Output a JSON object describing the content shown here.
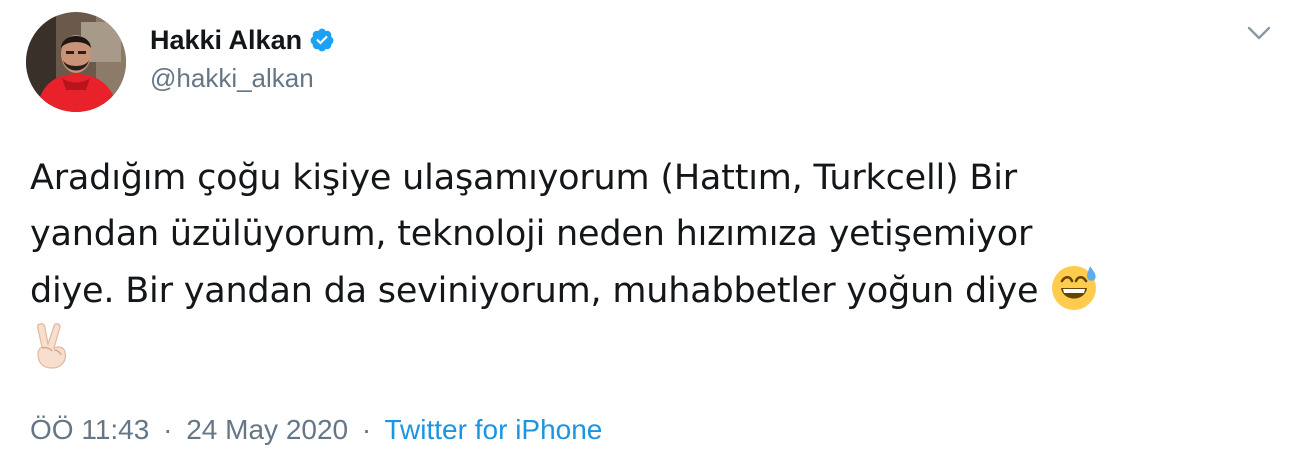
{
  "author": {
    "display_name": "Hakki Alkan",
    "handle": "@hakki_alkan",
    "verified": true,
    "avatar_icon": "profile-photo"
  },
  "tweet": {
    "line1": "Aradığım çoğu kişiye ulaşamıyorum (Hattım, Turkcell) Bir",
    "line2": "yandan üzülüyorum, teknoloji neden hızımıza yetişemiyor",
    "line3": "diye. Bir yandan da seviniyorum, muhabbetler yoğun diye",
    "emojis": [
      "grinning-face-with-sweat",
      "victory-hand-light-skin-tone"
    ]
  },
  "meta": {
    "time": "ÖÖ 11:43",
    "separator": "·",
    "date": "24 May 2020",
    "source": "Twitter for iPhone"
  },
  "colors": {
    "text": "#14171a",
    "secondary": "#657786",
    "link": "#1b95e0",
    "verified": "#1da1f2"
  }
}
